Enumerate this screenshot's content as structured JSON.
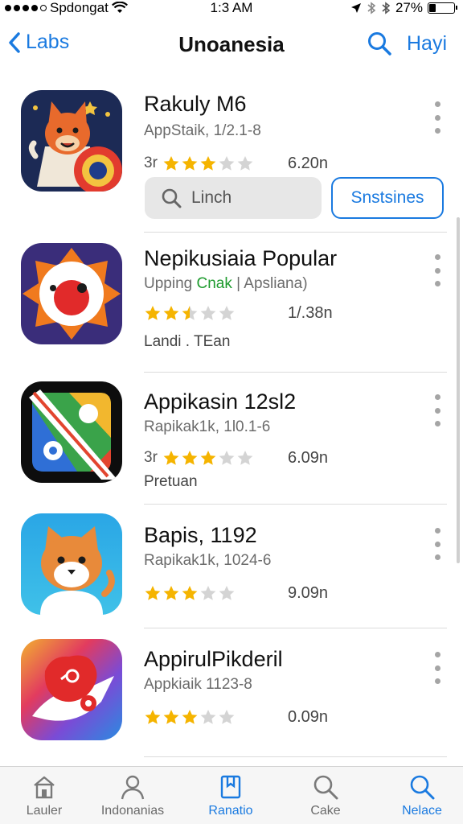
{
  "status_bar": {
    "carrier": "Spdongat",
    "time": "1:3 AM",
    "battery": "27%",
    "battery_level": 0.27
  },
  "nav": {
    "back_label": "Labs",
    "title": "Unoanesia",
    "right_label": "Hayi"
  },
  "accent_color": "#1a7ae0",
  "star_color": "#f5b400",
  "apps": [
    {
      "title": "Rakuly M6",
      "subtitle": "AppStaik, 1/2.1-8",
      "rating_prefix": "3r",
      "rating": 3,
      "size": "6.20n",
      "icon": "fox-mascot-icon",
      "search_label": "Linch",
      "button_label": "Snstsines"
    },
    {
      "title": "Nepikusiaia Popular",
      "subtitle_a": "Upping",
      "subtitle_green": "Cnak",
      "subtitle_b": "| Apsliana)",
      "rating": 2.5,
      "size": "1/.38n",
      "extra": "Landi . TEan",
      "icon": "red-circle-emblem-icon"
    },
    {
      "title": "Appikasin 12sl2",
      "subtitle": "Rapikak1k, 1l0.1-6",
      "rating_prefix": "3r",
      "rating": 3,
      "size": "6.09n",
      "extra": "Pretuan",
      "icon": "map-icon"
    },
    {
      "title": "Bapis, 1192",
      "subtitle": "Rapikak1k, 1024-6",
      "rating": 3,
      "size": "9.09n",
      "icon": "cat-icon"
    },
    {
      "title": "AppirulPikderil",
      "subtitle": "Appkiaik 1123-8",
      "rating": 3,
      "size": "0.09n",
      "icon": "rainbow-fish-icon"
    }
  ],
  "tabs": [
    {
      "label": "Lauler",
      "icon": "home-icon",
      "active": false
    },
    {
      "label": "Indonanias",
      "icon": "person-icon",
      "active": false
    },
    {
      "label": "Ranatio",
      "icon": "bookmark-icon",
      "active": true
    },
    {
      "label": "Cake",
      "icon": "search-icon",
      "active": false
    },
    {
      "label": "Nelace",
      "icon": "search-icon",
      "active": true
    }
  ]
}
